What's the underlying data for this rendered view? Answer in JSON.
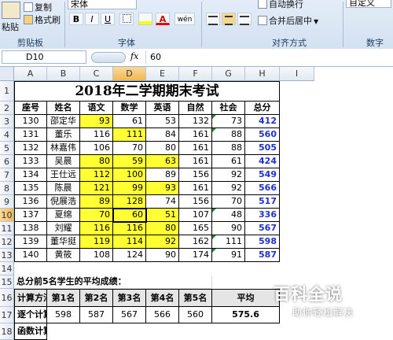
{
  "ribbon": {
    "clipboard": {
      "copy": "复制",
      "paste": "粘贴",
      "format_painter": "格式刷",
      "group": "剪贴板"
    },
    "font": {
      "name": "宋体",
      "group": "字体",
      "bold": "B",
      "italic": "I",
      "underline": "U",
      "color_a": "A",
      "wen": "wén"
    },
    "align": {
      "wrap": "自动换行",
      "merge": "合并后居中",
      "group": "对齐方式"
    },
    "number": {
      "format": "自定义",
      "group": "数字"
    }
  },
  "formula_bar": {
    "cell_ref": "D10",
    "fx": "fx",
    "value": "60"
  },
  "columns": [
    "A",
    "B",
    "C",
    "D",
    "E",
    "F",
    "G",
    "H",
    "I"
  ],
  "rows": [
    "1",
    "2",
    "3",
    "4",
    "5",
    "6",
    "7",
    "8",
    "9",
    "10",
    "11",
    "12",
    "13",
    "14",
    "15",
    "16",
    "17",
    "18"
  ],
  "sheet": {
    "title": "2018年二学期期末考试",
    "headers": [
      "座号",
      "姓名",
      "语文",
      "数学",
      "英语",
      "自然",
      "社会",
      "总分"
    ],
    "records": [
      [
        "130",
        "邵定华",
        "93",
        "61",
        "53",
        "132",
        "73",
        "412"
      ],
      [
        "131",
        "董乐",
        "116",
        "111",
        "84",
        "161",
        "88",
        "560"
      ],
      [
        "132",
        "林嘉伟",
        "106",
        "70",
        "80",
        "161",
        "88",
        "505"
      ],
      [
        "133",
        "吴晨",
        "80",
        "59",
        "63",
        "161",
        "61",
        "424"
      ],
      [
        "134",
        "王仕远",
        "112",
        "100",
        "89",
        "156",
        "92",
        "549"
      ],
      [
        "135",
        "陈晨",
        "121",
        "99",
        "93",
        "161",
        "92",
        "566"
      ],
      [
        "136",
        "倪展浩",
        "89",
        "128",
        "74",
        "156",
        "70",
        "517"
      ],
      [
        "137",
        "夏绵",
        "70",
        "60",
        "51",
        "107",
        "48",
        "336"
      ],
      [
        "138",
        "刘耀",
        "116",
        "116",
        "80",
        "165",
        "90",
        "567"
      ],
      [
        "139",
        "董华挺",
        "119",
        "114",
        "92",
        "162",
        "111",
        "598"
      ],
      [
        "140",
        "黄筱",
        "108",
        "124",
        "90",
        "174",
        "91",
        "587"
      ]
    ],
    "summary_note": "总分前5名学生的平均成绩：",
    "avg_table": {
      "headers": [
        "计算方法",
        "第1名",
        "第2名",
        "第3名",
        "第4名",
        "第5名",
        "平均"
      ],
      "row1": [
        "逐个计算",
        "598",
        "587",
        "567",
        "566",
        "560",
        "575.6"
      ],
      "row2_label": "函数计算"
    }
  },
  "watermark": {
    "main": "百科全说",
    "sub": "助你轻松解决"
  },
  "colors": {
    "highlight": "#ffff33",
    "total_text": "#1f2fd0",
    "selection_header": "#f1b952"
  }
}
